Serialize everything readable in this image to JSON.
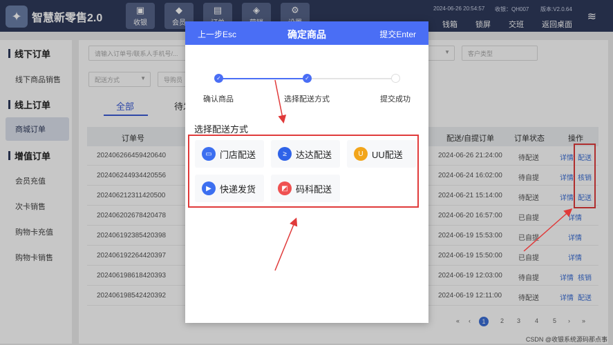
{
  "app": {
    "title": "智慧新零售2.0"
  },
  "nav": [
    {
      "label": "收银",
      "icon": "cash-icon"
    },
    {
      "label": "会员",
      "icon": "diamond-icon"
    },
    {
      "label": "订单",
      "icon": "order-icon"
    },
    {
      "label": "营销",
      "icon": "tag-icon"
    },
    {
      "label": "设置",
      "icon": "gear-icon"
    }
  ],
  "header_meta": {
    "datetime": "2024-06-26 20:54:57",
    "cashier": "收银：QH007",
    "version": "版本:V2.0.64"
  },
  "header_actions": [
    "钱箱",
    "锁屏",
    "交班",
    "返回桌面"
  ],
  "sidebar": {
    "sections": [
      {
        "title": "线下订单",
        "items": [
          "线下商品销售"
        ]
      },
      {
        "title": "线上订单",
        "items": [
          "商城订单"
        ]
      },
      {
        "title": "增值订单",
        "items": [
          "会员充值",
          "次卡销售",
          "购物卡充值",
          "购物卡销售"
        ]
      }
    ]
  },
  "filters": {
    "search_placeholder": "请输入订单号/联系人手机号/...",
    "delivery_placeholder": "配送方式",
    "guide_placeholder": "导购员",
    "customer_type": "客户类型"
  },
  "tabs": [
    "全部",
    "待发"
  ],
  "table": {
    "headers": [
      "订单号",
      "配送/自提订单",
      "订单状态",
      "操作"
    ],
    "rows": [
      {
        "id": "2024062664594206​40",
        "time": "2024-06-26 21:24:00",
        "status": "待配送",
        "actions": [
          "详情",
          "配送"
        ]
      },
      {
        "id": "20240624493442055​6",
        "time": "2024-06-24 16:02:00",
        "status": "待自提",
        "actions": [
          "详情",
          "核销"
        ]
      },
      {
        "id": "20240621231142050​0",
        "time": "2024-06-21 15:14:00",
        "status": "待配送",
        "actions": [
          "详情",
          "配送"
        ]
      },
      {
        "id": "20240620267842047​8",
        "time": "2024-06-20 16:57:00",
        "status": "已自提",
        "actions": [
          "详情"
        ]
      },
      {
        "id": "20240619238542039​8",
        "time": "2024-06-19 15:53:00",
        "status": "已自提",
        "actions": [
          "详情"
        ]
      },
      {
        "id": "20240619226442039​7",
        "time": "2024-06-19 15:50:00",
        "status": "已自提",
        "actions": [
          "详情"
        ]
      },
      {
        "id": "20240619861842039​3",
        "time": "2024-06-19 12:03:00",
        "status": "待自提",
        "actions": [
          "详情",
          "核销"
        ]
      },
      {
        "id": "20240619854242039​2",
        "time": "2024-06-19 12:11:00",
        "status": "待配送",
        "actions": [
          "详情",
          "配送"
        ]
      }
    ]
  },
  "pagination": {
    "pages": [
      "1",
      "2",
      "3",
      "4",
      "5"
    ],
    "current": "1"
  },
  "watermark": "CSDN @收银系统源码那点事",
  "modal": {
    "back": "上一步Esc",
    "title": "确定商品",
    "submit": "提交Enter",
    "steps": [
      "确认商品",
      "选择配送方式",
      "提交成功"
    ],
    "section_title": "选择配送方式",
    "options": [
      {
        "label": "门店配送",
        "icon": "store-icon",
        "color": "#3c6ff0"
      },
      {
        "label": "达达配送",
        "icon": "dada-icon",
        "color": "#2f63e8"
      },
      {
        "label": "UU配送",
        "icon": "uu-icon",
        "color": "#f2a51a"
      },
      {
        "label": "快递发货",
        "icon": "truck-icon",
        "color": "#3c6ff0"
      },
      {
        "label": "码科配送",
        "icon": "mako-icon",
        "color": "#ef5151"
      }
    ]
  }
}
